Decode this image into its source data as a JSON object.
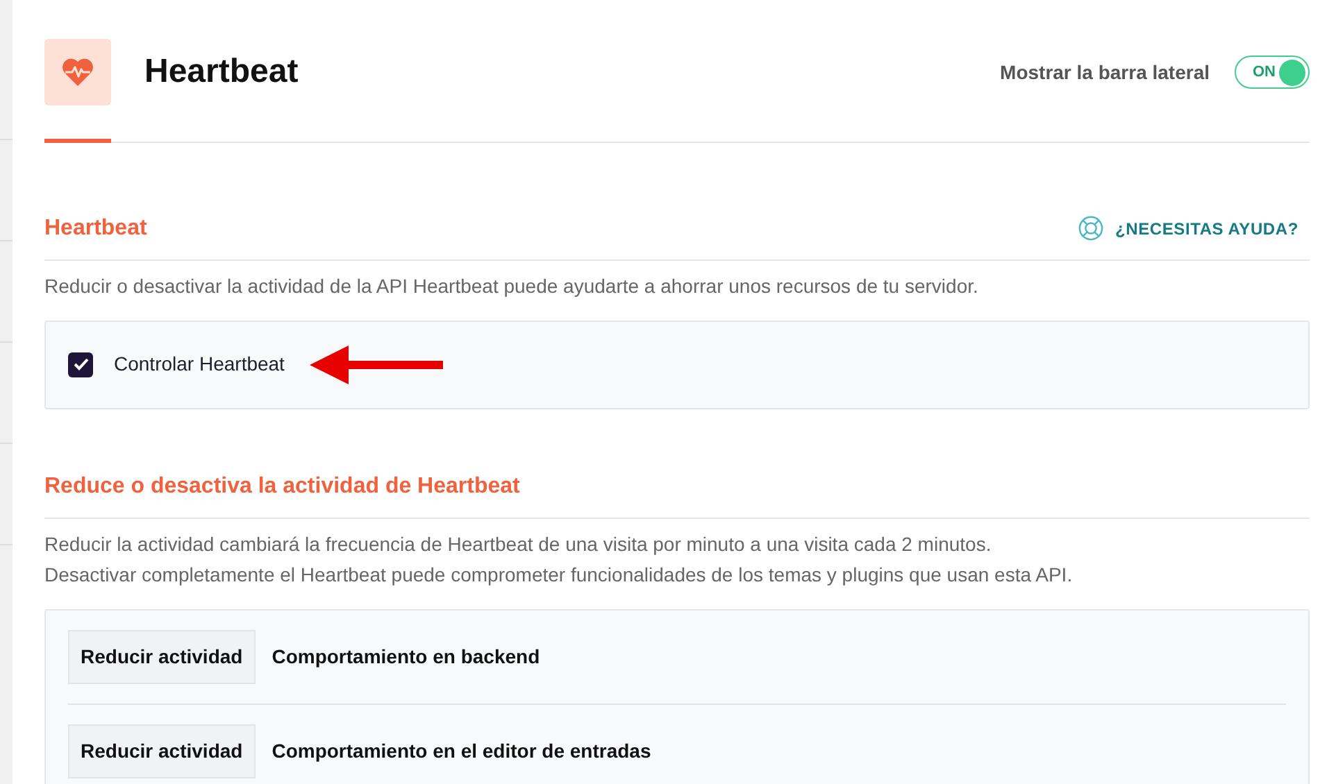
{
  "header": {
    "title": "Heartbeat",
    "sidebar_toggle": {
      "label": "Mostrar la barra lateral",
      "state_text": "ON",
      "on": true
    }
  },
  "sections": [
    {
      "title": "Heartbeat",
      "help_link": "¿NECESITAS AYUDA?",
      "description": [
        "Reducir o desactivar la actividad de la API Heartbeat puede ayudarte a ahorrar unos recursos de tu servidor."
      ],
      "options": [
        {
          "kind": "checkbox",
          "label": "Controlar Heartbeat",
          "checked": true,
          "annotated": true
        }
      ]
    },
    {
      "title": "Reduce o desactiva la actividad de Heartbeat",
      "description": [
        "Reducir la actividad cambiará la frecuencia de Heartbeat de una visita por minuto a una visita cada 2 minutos.",
        "Desactivar completamente el Heartbeat puede comprometer funcionalidades de los temas y plugins que usan esta API."
      ],
      "options": [
        {
          "kind": "select",
          "value": "Reducir actividad",
          "label": "Comportamiento en backend"
        },
        {
          "kind": "select",
          "value": "Reducir actividad",
          "label": "Comportamiento en el editor de entradas"
        }
      ]
    }
  ]
}
